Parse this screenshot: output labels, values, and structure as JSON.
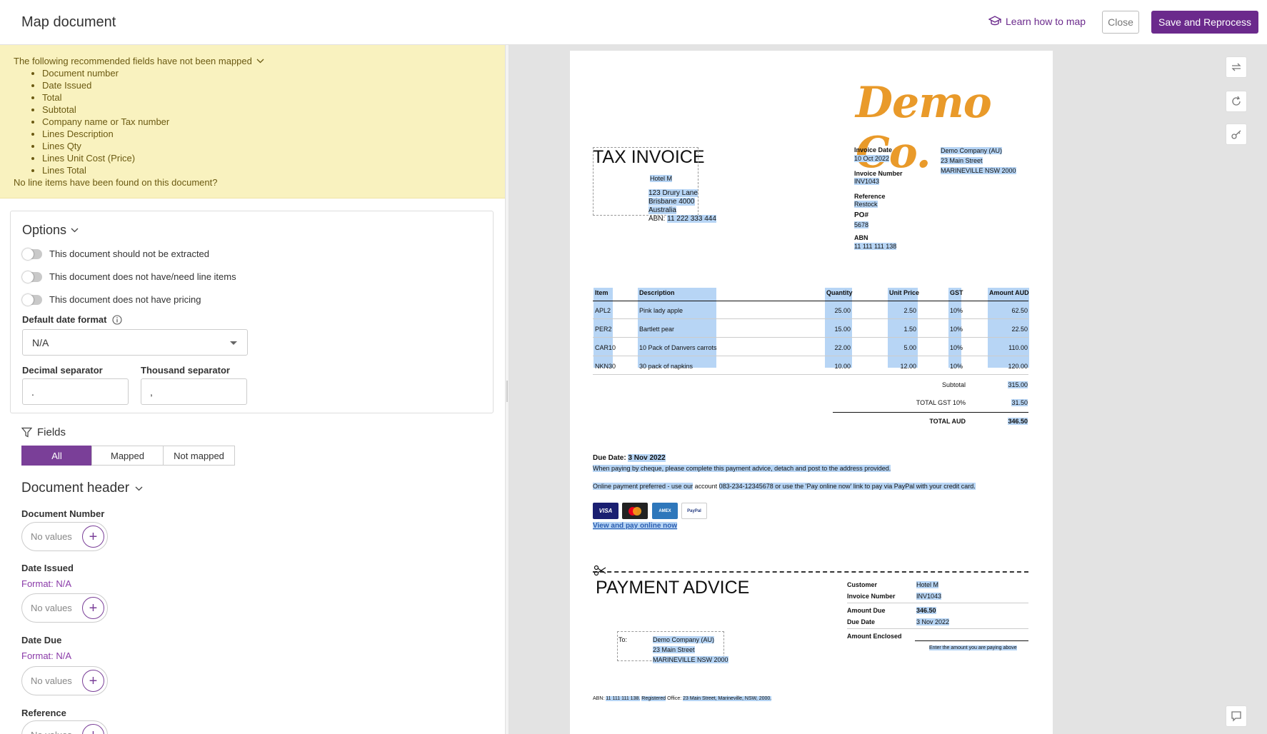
{
  "header": {
    "title": "Map document",
    "learn_label": "Learn how to map",
    "close_label": "Close",
    "save_label": "Save and Reprocess"
  },
  "warning": {
    "heading": "The following recommended fields have not been mapped",
    "items": [
      "Document number",
      "Date Issued",
      "Total",
      "Subtotal",
      "Company name or Tax number",
      "Lines Description",
      "Lines Qty",
      "Lines Unit Cost (Price)",
      "Lines Total"
    ],
    "footer": "No line items have been found on this document?"
  },
  "options": {
    "title": "Options",
    "toggles": [
      "This document should not be extracted",
      "This document does not have/need line items",
      "This document does not have pricing"
    ],
    "date_format_label": "Default date format",
    "date_format_value": "N/A",
    "decimal_label": "Decimal separator",
    "decimal_value": ".",
    "thousand_label": "Thousand separator",
    "thousand_value": ","
  },
  "fields": {
    "title": "Fields",
    "filters": [
      "All",
      "Mapped",
      "Not mapped"
    ],
    "active_filter": "All"
  },
  "document_header": {
    "title": "Document header",
    "no_values": "No values",
    "items": [
      {
        "label": "Document Number",
        "format": ""
      },
      {
        "label": "Date Issued",
        "format": "Format: N/A"
      },
      {
        "label": "Date Due",
        "format": "Format: N/A"
      },
      {
        "label": "Reference",
        "format": ""
      }
    ]
  },
  "invoice": {
    "logo": "Demo Co.",
    "title": "TAX INVOICE",
    "bill_to": [
      "Hotel M",
      "123 Drury Lane",
      "Brisbane 4000",
      "Australia"
    ],
    "abn_label": "ABN:",
    "abn_value": "11 222 333 444",
    "meta": [
      {
        "label": "Invoice Date",
        "value": "10 Oct 2022"
      },
      {
        "label": "Invoice Number",
        "value": "INV1043"
      },
      {
        "label": "Reference",
        "value": "Restock"
      },
      {
        "label": "PO#",
        "value": "5678"
      },
      {
        "label": "ABN",
        "value": "11 111 111 138"
      }
    ],
    "company": [
      "Demo Company (AU)",
      "23 Main Street",
      "MARINEVILLE NSW 2000"
    ],
    "columns": [
      "Item",
      "Description",
      "Quantity",
      "Unit Price",
      "GST",
      "Amount AUD"
    ],
    "rows": [
      [
        "APL2",
        "Pink lady apple",
        "25.00",
        "2.50",
        "10%",
        "62.50"
      ],
      [
        "PER2",
        "Bartlett pear",
        "15.00",
        "1.50",
        "10%",
        "22.50"
      ],
      [
        "CAR10",
        "10 Pack of Danvers carrots",
        "22.00",
        "5.00",
        "10%",
        "110.00"
      ],
      [
        "NKN30",
        "30 pack of napkins",
        "10.00",
        "12.00",
        "10%",
        "120.00"
      ]
    ],
    "subtotal_label": "Subtotal",
    "subtotal_value": "315.00",
    "gst_label": "TOTAL  GST  10%",
    "gst_value": "31.50",
    "total_label": "TOTAL AUD",
    "total_value": "346.50",
    "due_label": "Due Date:",
    "due_value": "3 Nov 2022",
    "cheque_note": "When paying by cheque, please complete this payment advice, detach and post to the address provided.",
    "online_note_a": "Online payment preferred - use our",
    "online_note_b": "account",
    "online_note_c": "083-234-12345678 or use the 'Pay online now' link to pay via PayPal with your credit card.",
    "pay_badges": [
      "VISA",
      "",
      "AMEX",
      "PayPal"
    ],
    "pay_link": "View and pay online now",
    "advice_title": "PAYMENT ADVICE",
    "advice": [
      {
        "label": "Customer",
        "value": "Hotel M"
      },
      {
        "label": "Invoice Number",
        "value": "INV1043"
      },
      {
        "label": "Amount Due",
        "value": "346.50"
      },
      {
        "label": "Due Date",
        "value": "3 Nov 2022"
      },
      {
        "label": "Amount Enclosed",
        "value": ""
      }
    ],
    "enclosed_hint": "Enter the amount you are paying above",
    "to_label": "To:",
    "footer_a": "ABN:",
    "footer_b": "11 111 111 138.",
    "footer_c": "Registered",
    "footer_d": "Office:",
    "footer_e": "23 Main Street, Marineville, NSW, 2000."
  },
  "colors": {
    "accent": "#6b2a8c",
    "warning_bg": "#f9f2bf",
    "highlight": "#b7d5f5",
    "logo": "#e99a2a"
  }
}
